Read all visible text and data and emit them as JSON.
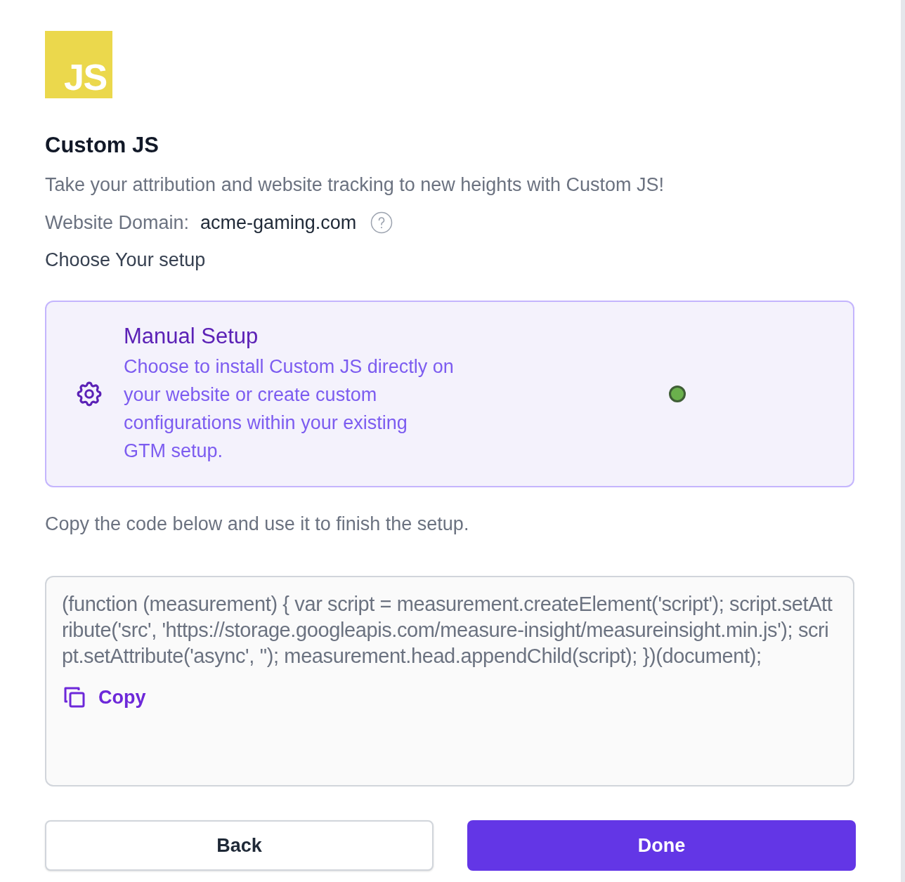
{
  "logo": {
    "text": "JS"
  },
  "title": "Custom JS",
  "description": "Take your attribution and website tracking to new heights with Custom JS!",
  "domain": {
    "label": "Website Domain:",
    "value": "acme-gaming.com"
  },
  "setup_heading": "Choose Your setup",
  "options": [
    {
      "title": "Manual Setup",
      "description": "Choose to install Custom JS directly on your website or create custom configurations within your existing GTM setup.",
      "selected": true
    }
  ],
  "instructions": "Copy the code below and use it to finish the setup.",
  "code": "(function (measurement) { var script = measurement.createElement('script'); script.setAttribute('src', 'https://storage.googleapis.com/measure-insight/measureinsight.min.js'); script.setAttribute('async', ''); measurement.head.appendChild(script); })(document);",
  "copy_button": "Copy",
  "buttons": [
    {
      "label": "Back",
      "kind": "secondary"
    },
    {
      "label": "Done",
      "kind": "primary"
    }
  ]
}
